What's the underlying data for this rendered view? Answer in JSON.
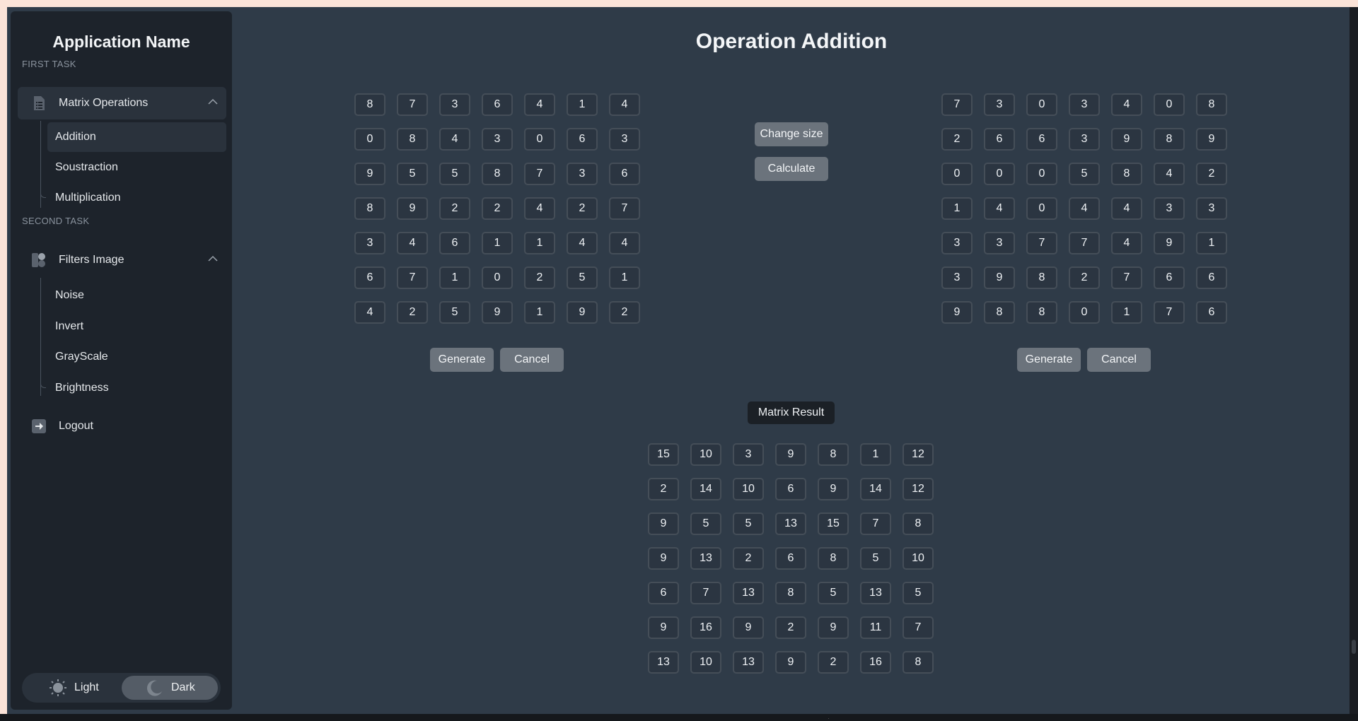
{
  "sidebar": {
    "app_name": "Application Name",
    "sections": [
      {
        "title": "FIRST TASK",
        "group": {
          "label": "Matrix Operations",
          "icon": "document-list-icon",
          "expanded": true
        },
        "items": [
          {
            "label": "Addition",
            "active": true
          },
          {
            "label": "Soustraction",
            "active": false
          },
          {
            "label": "Multiplication",
            "active": false
          }
        ]
      },
      {
        "title": "SECOND TASK",
        "group": {
          "label": "Filters Image",
          "icon": "filters-icon",
          "expanded": true
        },
        "items": [
          {
            "label": "Noise",
            "active": false
          },
          {
            "label": "Invert",
            "active": false
          },
          {
            "label": "GrayScale",
            "active": false
          },
          {
            "label": "Brightness",
            "active": false
          }
        ]
      }
    ],
    "logout": {
      "label": "Logout",
      "icon": "logout-icon"
    },
    "theme": {
      "light_label": "Light",
      "dark_label": "Dark",
      "selected": "Dark"
    }
  },
  "main": {
    "title": "Operation Addition",
    "matrix_a": [
      [
        8,
        7,
        3,
        6,
        4,
        1,
        4
      ],
      [
        0,
        8,
        4,
        3,
        0,
        6,
        3
      ],
      [
        9,
        5,
        5,
        8,
        7,
        3,
        6
      ],
      [
        8,
        9,
        2,
        2,
        4,
        2,
        7
      ],
      [
        3,
        4,
        6,
        1,
        1,
        4,
        4
      ],
      [
        6,
        7,
        1,
        0,
        2,
        5,
        1
      ],
      [
        4,
        2,
        5,
        9,
        1,
        9,
        2
      ]
    ],
    "matrix_b": [
      [
        7,
        3,
        0,
        3,
        4,
        0,
        8
      ],
      [
        2,
        6,
        6,
        3,
        9,
        8,
        9
      ],
      [
        0,
        0,
        0,
        5,
        8,
        4,
        2
      ],
      [
        1,
        4,
        0,
        4,
        4,
        3,
        3
      ],
      [
        3,
        3,
        7,
        7,
        4,
        9,
        1
      ],
      [
        3,
        9,
        8,
        2,
        7,
        6,
        6
      ],
      [
        9,
        8,
        8,
        0,
        1,
        7,
        6
      ]
    ],
    "matrix_result": [
      [
        15,
        10,
        3,
        9,
        8,
        1,
        12
      ],
      [
        2,
        14,
        10,
        6,
        9,
        14,
        12
      ],
      [
        9,
        5,
        5,
        13,
        15,
        7,
        8
      ],
      [
        9,
        13,
        2,
        6,
        8,
        5,
        10
      ],
      [
        6,
        7,
        13,
        8,
        5,
        13,
        5
      ],
      [
        9,
        16,
        9,
        2,
        9,
        11,
        7
      ],
      [
        13,
        10,
        13,
        9,
        2,
        16,
        8
      ]
    ],
    "buttons": {
      "change_size": "Change size",
      "calculate": "Calculate",
      "generate_a": "Generate",
      "cancel_a": "Cancel",
      "generate_b": "Generate",
      "cancel_b": "Cancel"
    },
    "result_label": "Matrix Result"
  },
  "colors": {
    "background": "#2f3b48",
    "sidebar": "#1d232b",
    "button": "#6b737c",
    "cell_border": "#454e58"
  }
}
